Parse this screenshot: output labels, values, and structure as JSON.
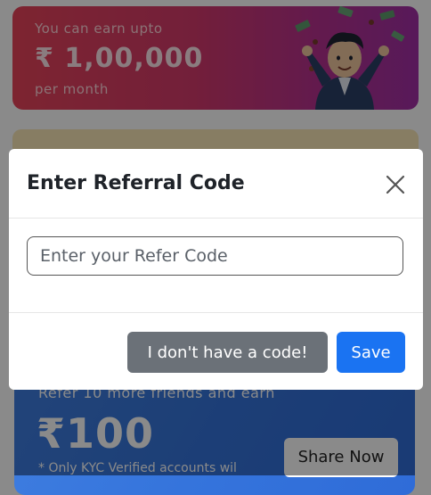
{
  "background": {
    "earn_banner": {
      "subtitle": "You can earn upto",
      "amount": "₹ 1,00,000",
      "period": "per month"
    },
    "refer_card": {
      "text": "Refer 10 more friends and earn",
      "amount": "₹100",
      "note": "* Only KYC Verified accounts wil",
      "share_label": "Share Now"
    }
  },
  "modal": {
    "title": "Enter Referral Code",
    "input_placeholder": "Enter your Refer Code",
    "input_value": "",
    "no_code_label": "I don't have a code!",
    "save_label": "Save"
  },
  "icons": {
    "close": "close-icon"
  },
  "colors": {
    "save_button": "#1a73f2",
    "secondary_button": "#6b7178",
    "earn_banner_start": "#e8445a",
    "earn_banner_end": "#a22fa6",
    "refer_card": "#3574dc"
  }
}
